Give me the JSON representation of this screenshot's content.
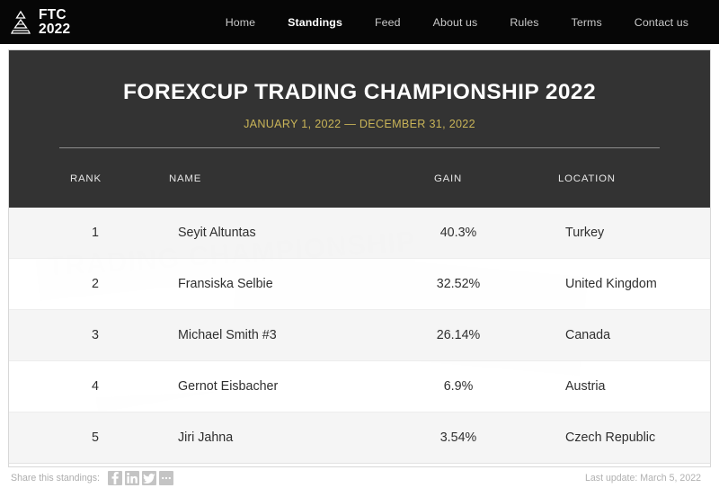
{
  "navbar": {
    "brand": {
      "icon": "pyramid-logo-icon",
      "line1": "FTC",
      "line2": "2022"
    },
    "links": [
      {
        "label": "Home",
        "active": false,
        "name": "nav-link-home"
      },
      {
        "label": "Standings",
        "active": true,
        "name": "nav-link-standings"
      },
      {
        "label": "Feed",
        "active": false,
        "name": "nav-link-feed"
      },
      {
        "label": "About us",
        "active": false,
        "name": "nav-link-about-us"
      },
      {
        "label": "Rules",
        "active": false,
        "name": "nav-link-rules"
      },
      {
        "label": "Terms",
        "active": false,
        "name": "nav-link-terms"
      },
      {
        "label": "Contact us",
        "active": false,
        "name": "nav-link-contact-us"
      }
    ]
  },
  "card": {
    "title": "FOREXCUP TRADING CHAMPIONSHIP 2022",
    "dates": "JANUARY 1, 2022 — DECEMBER 31, 2022",
    "watermark_text": "TRADING CHAMPIONSHIP",
    "colors": {
      "header_bg": "#333333",
      "nav_bg": "#060606",
      "accent_gold": "#c9b458",
      "row_odd": "#f4f4f4",
      "row_even": "#ffffff"
    },
    "columns": [
      {
        "label": "RANK"
      },
      {
        "label": "NAME"
      },
      {
        "label": "GAIN"
      },
      {
        "label": "LOCATION"
      }
    ],
    "rows": [
      {
        "rank": "1",
        "name": "Seyit Altuntas",
        "gain": "40.3%",
        "location": "Turkey"
      },
      {
        "rank": "2",
        "name": "Fransiska Selbie",
        "gain": "32.52%",
        "location": "United Kingdom"
      },
      {
        "rank": "3",
        "name": "Michael Smith #3",
        "gain": "26.14%",
        "location": "Canada"
      },
      {
        "rank": "4",
        "name": "Gernot Eisbacher",
        "gain": "6.9%",
        "location": "Austria"
      },
      {
        "rank": "5",
        "name": "Jiri Jahna",
        "gain": "3.54%",
        "location": "Czech Republic"
      }
    ]
  },
  "footer": {
    "share_label": "Share this standings:",
    "share_buttons": [
      {
        "icon": "facebook-icon",
        "name": "share-facebook-button"
      },
      {
        "icon": "linkedin-icon",
        "name": "share-linkedin-button"
      },
      {
        "icon": "twitter-icon",
        "name": "share-twitter-button"
      },
      {
        "icon": "more-icon",
        "name": "share-more-button"
      }
    ],
    "last_update": "Last update: March 5, 2022"
  }
}
